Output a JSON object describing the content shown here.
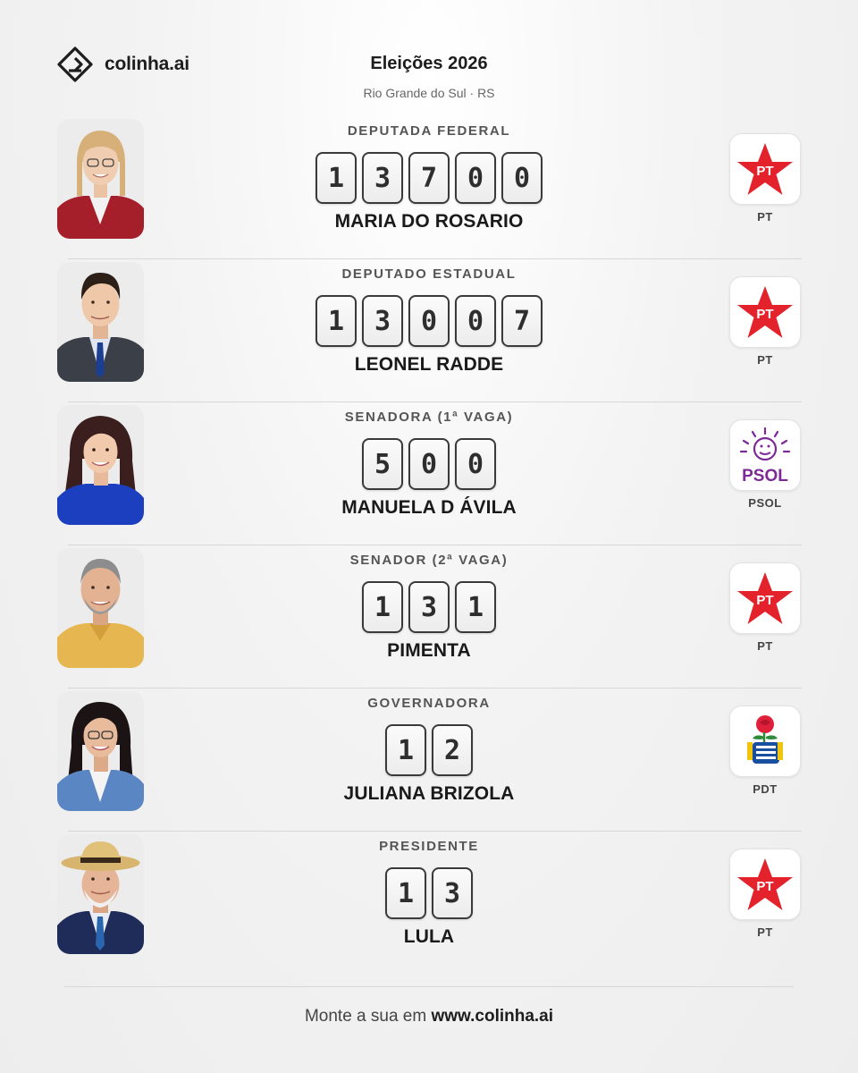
{
  "brand": {
    "name": "colinha.ai",
    "icon": "colinha-logo-icon"
  },
  "header": {
    "title": "Eleições 2026",
    "subtitle": "Rio Grande do Sul · RS"
  },
  "rows": [
    {
      "office": "DEPUTADA FEDERAL",
      "number": "13700",
      "name": "MARIA DO ROSARIO",
      "party": "PT",
      "party_icon": "pt-star-icon"
    },
    {
      "office": "DEPUTADO ESTADUAL",
      "number": "13007",
      "name": "LEONEL RADDE",
      "party": "PT",
      "party_icon": "pt-star-icon"
    },
    {
      "office": "SENADORA (1ª VAGA)",
      "number": "500",
      "name": "MANUELA D ÁVILA",
      "party": "PSOL",
      "party_icon": "psol-sun-icon"
    },
    {
      "office": "SENADOR (2ª VAGA)",
      "number": "131",
      "name": "PIMENTA",
      "party": "PT",
      "party_icon": "pt-star-icon"
    },
    {
      "office": "GOVERNADORA",
      "number": "12",
      "name": "JULIANA BRIZOLA",
      "party": "PDT",
      "party_icon": "pdt-rose-fist-icon"
    },
    {
      "office": "PRESIDENTE",
      "number": "13",
      "name": "LULA",
      "party": "PT",
      "party_icon": "pt-star-icon"
    }
  ],
  "footer": {
    "prefix": "Monte a sua em",
    "url": "www.colinha.ai"
  },
  "colors": {
    "pt_red": "#e3222b",
    "psol_purple": "#7b2a96",
    "pdt_blue": "#1a4fa0",
    "digit_border": "#3a3a3a"
  }
}
